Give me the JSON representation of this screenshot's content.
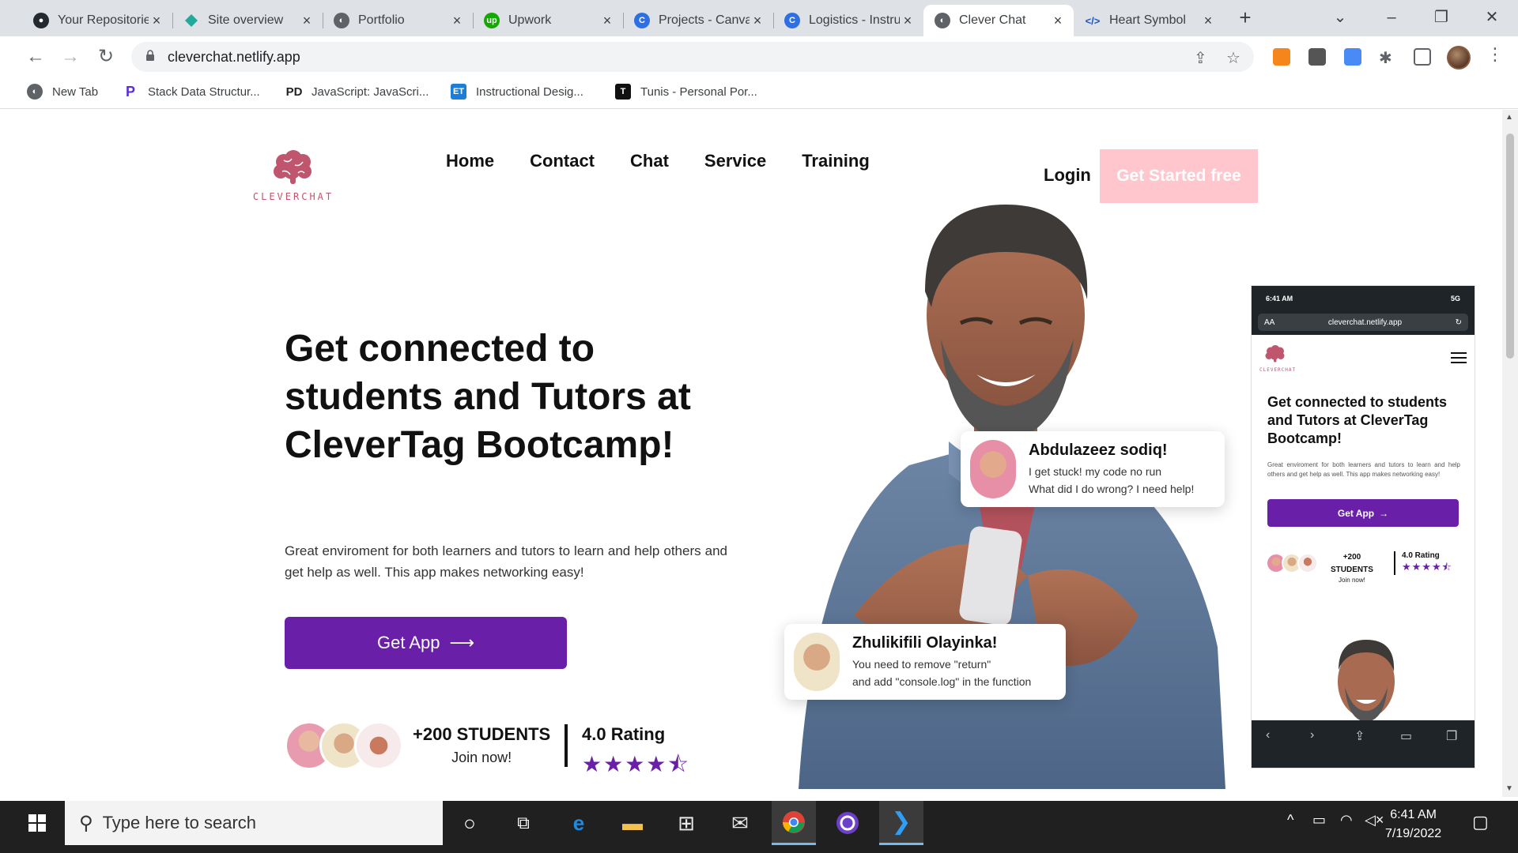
{
  "browser": {
    "tabs": [
      {
        "title": "Your Repositories",
        "icon": "github-icon",
        "active": false
      },
      {
        "title": "Site overview",
        "icon": "netlify-icon",
        "active": false
      },
      {
        "title": "Portfolio",
        "icon": "globe-icon",
        "active": false
      },
      {
        "title": "Upwork",
        "icon": "upwork-icon",
        "active": false
      },
      {
        "title": "Projects - Canva",
        "icon": "canva-icon",
        "active": false
      },
      {
        "title": "Logistics - Instructional",
        "icon": "canva-icon",
        "active": false
      },
      {
        "title": "Clever Chat",
        "icon": "globe-icon",
        "active": true
      },
      {
        "title": "Heart Symbol",
        "icon": "code-icon",
        "active": false
      }
    ],
    "url": "cleverchat.netlify.app",
    "bookmarks": [
      {
        "label": "New Tab",
        "icon": "globe-icon"
      },
      {
        "label": "Stack Data Structur...",
        "icon": "p-icon"
      },
      {
        "label": "JavaScript: JavaScri...",
        "icon": "pd-icon"
      },
      {
        "label": "Instructional Desig...",
        "icon": "et-icon"
      },
      {
        "label": "Tunis - Personal Por...",
        "icon": "t-icon"
      }
    ]
  },
  "site": {
    "brand": "CLEVERCHAT",
    "nav": [
      "Home",
      "Contact",
      "Chat",
      "Service",
      "Training"
    ],
    "login": "Login",
    "cta": "Get Started free",
    "headline": "Get connected to students and Tutors at CleverTag Bootcamp!",
    "description": "Great enviroment for both learners and tutors to learn and help others and get help as well. This app makes networking easy!",
    "get_app": "Get App",
    "students_count": "+200 STUDENTS",
    "join_now": "Join now!",
    "rating_label": "4.0 Rating",
    "rating_stars": "★★★★⯪",
    "chat1": {
      "name": "Abdulazeez sodiq!",
      "line1": "I get stuck! my code no run",
      "line2": "What did I do wrong? I need help!"
    },
    "chat2": {
      "name": "Zhulikifili Olayinka!",
      "line1": "You need to remove \"return\"",
      "line2": "and add \"console.log\" in the function"
    }
  },
  "phone": {
    "time": "6:41 AM",
    "signal": "5G",
    "aa": "AA",
    "url": "cleverchat.netlify.app",
    "brand": "CLEVERCHAT",
    "headline": "Get connected to students and Tutors at CleverTag Bootcamp!",
    "description": "Great enviroment for both learners and tutors to learn and help others and get help as well. This app makes networking easy!",
    "get_app": "Get App",
    "students_count": "+200",
    "students_label": "STUDENTS",
    "join_now": "Join now!",
    "rating_label": "4.0 Rating",
    "rating_stars": "★★★★⯪"
  },
  "taskbar": {
    "search_placeholder": "Type here to search",
    "time": "6:41 AM",
    "date": "7/19/2022"
  },
  "colors": {
    "purple": "#6a1fa8",
    "pink": "#ffc7cd",
    "brain": "#c0566e"
  }
}
